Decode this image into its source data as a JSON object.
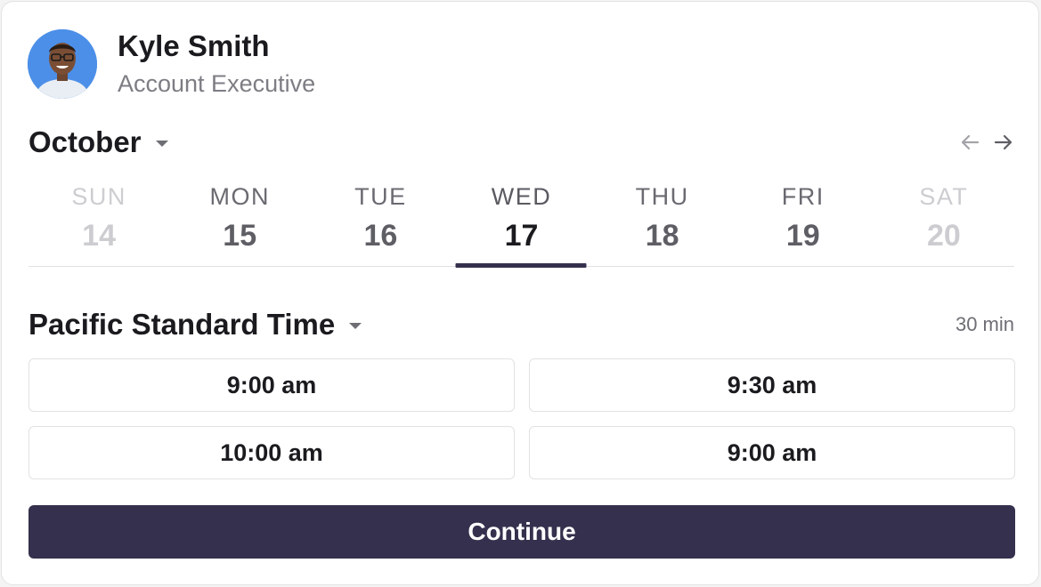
{
  "profile": {
    "name": "Kyle Smith",
    "role": "Account Executive"
  },
  "calendar": {
    "month": "October",
    "prev_icon": "arrow-left-icon",
    "next_icon": "arrow-right-icon",
    "days": [
      {
        "name": "SUN",
        "num": "14",
        "state": "muted"
      },
      {
        "name": "MON",
        "num": "15",
        "state": "normal"
      },
      {
        "name": "TUE",
        "num": "16",
        "state": "normal"
      },
      {
        "name": "WED",
        "num": "17",
        "state": "active"
      },
      {
        "name": "THU",
        "num": "18",
        "state": "normal"
      },
      {
        "name": "FRI",
        "num": "19",
        "state": "normal"
      },
      {
        "name": "SAT",
        "num": "20",
        "state": "muted"
      }
    ]
  },
  "timezone": {
    "label": "Pacific Standard Time",
    "duration": "30 min"
  },
  "slots": [
    "9:00 am",
    "9:30 am",
    "10:00 am",
    "9:00 am"
  ],
  "continue_label": "Continue",
  "colors": {
    "accent": "#35304d",
    "avatar_bg": "#4c8fe8"
  }
}
